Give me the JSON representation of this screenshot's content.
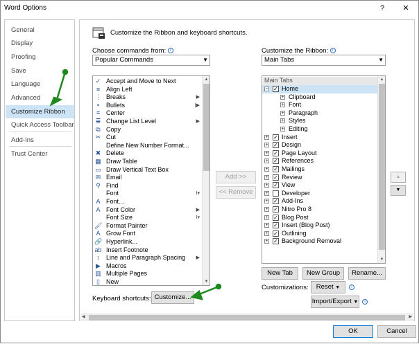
{
  "window": {
    "title": "Word Options",
    "help": "?",
    "close": "✕"
  },
  "nav": [
    {
      "label": "General"
    },
    {
      "label": "Display"
    },
    {
      "label": "Proofing"
    },
    {
      "label": "Save"
    },
    {
      "label": "Language"
    },
    {
      "label": "Advanced"
    },
    {
      "label": "Customize Ribbon",
      "selected": true
    },
    {
      "label": "Quick Access Toolbar"
    },
    {
      "label": "Add-Ins"
    },
    {
      "label": "Trust Center"
    }
  ],
  "header": {
    "text": "Customize the Ribbon and keyboard shortcuts."
  },
  "left": {
    "choose_label": "Choose commands from:",
    "choose_value": "Popular Commands",
    "commands": [
      {
        "label": "Accept and Move to Next",
        "icon": "accept-icon",
        "glyph": "✓"
      },
      {
        "label": "Align Left",
        "icon": "align-left-icon",
        "glyph": "≡"
      },
      {
        "label": "Breaks",
        "icon": "breaks-icon",
        "glyph": "⋮",
        "sub": "▶"
      },
      {
        "label": "Bullets",
        "icon": "bullets-icon",
        "glyph": "•",
        "sub": "|▶"
      },
      {
        "label": "Center",
        "icon": "center-icon",
        "glyph": "≡"
      },
      {
        "label": "Change List Level",
        "icon": "list-level-icon",
        "glyph": "≣",
        "sub": "▶"
      },
      {
        "label": "Copy",
        "icon": "copy-icon",
        "glyph": "⧉"
      },
      {
        "label": "Cut",
        "icon": "cut-icon",
        "glyph": "✂"
      },
      {
        "label": "Define New Number Format...",
        "icon": "",
        "glyph": ""
      },
      {
        "label": "Delete",
        "icon": "delete-icon",
        "glyph": "✖"
      },
      {
        "label": "Draw Table",
        "icon": "draw-table-icon",
        "glyph": "▦"
      },
      {
        "label": "Draw Vertical Text Box",
        "icon": "text-box-icon",
        "glyph": "▭"
      },
      {
        "label": "Email",
        "icon": "email-icon",
        "glyph": "✉"
      },
      {
        "label": "Find",
        "icon": "find-icon",
        "glyph": "⚲"
      },
      {
        "label": "Font",
        "icon": "",
        "glyph": "",
        "sub": "I▾"
      },
      {
        "label": "Font...",
        "icon": "font-dialog-icon",
        "glyph": "A"
      },
      {
        "label": "Font Color",
        "icon": "font-color-icon",
        "glyph": "A",
        "sub": "▶"
      },
      {
        "label": "Font Size",
        "icon": "",
        "glyph": "",
        "sub": "I▾"
      },
      {
        "label": "Format Painter",
        "icon": "format-painter-icon",
        "glyph": "🖌"
      },
      {
        "label": "Grow Font",
        "icon": "grow-font-icon",
        "glyph": "A"
      },
      {
        "label": "Hyperlink...",
        "icon": "hyperlink-icon",
        "glyph": "🔗"
      },
      {
        "label": "Insert Footnote",
        "icon": "footnote-icon",
        "glyph": "ab"
      },
      {
        "label": "Line and Paragraph Spacing",
        "icon": "spacing-icon",
        "glyph": "↕",
        "sub": "▶"
      },
      {
        "label": "Macros",
        "icon": "macros-icon",
        "glyph": "▶"
      },
      {
        "label": "Multiple Pages",
        "icon": "pages-icon",
        "glyph": "▥"
      },
      {
        "label": "New",
        "icon": "new-doc-icon",
        "glyph": "▯"
      }
    ],
    "kbd_label": "Keyboard shortcuts:",
    "customize_btn": "Customize..."
  },
  "mid": {
    "add": "Add >>",
    "remove": "<< Remove"
  },
  "right": {
    "customize_label": "Customize the Ribbon:",
    "customize_value": "Main Tabs",
    "tree_header": "Main Tabs",
    "tree": [
      {
        "label": "Home",
        "level": 0,
        "exp": "−",
        "checked": true,
        "sel": true
      },
      {
        "label": "Clipboard",
        "level": 1,
        "exp": "+"
      },
      {
        "label": "Font",
        "level": 1,
        "exp": "+"
      },
      {
        "label": "Paragraph",
        "level": 1,
        "exp": "+"
      },
      {
        "label": "Styles",
        "level": 1,
        "exp": "+"
      },
      {
        "label": "Editing",
        "level": 1,
        "exp": "+"
      },
      {
        "label": "Insert",
        "level": 0,
        "exp": "+",
        "checked": true
      },
      {
        "label": "Design",
        "level": 0,
        "exp": "+",
        "checked": true
      },
      {
        "label": "Page Layout",
        "level": 0,
        "exp": "+",
        "checked": true
      },
      {
        "label": "References",
        "level": 0,
        "exp": "+",
        "checked": true
      },
      {
        "label": "Mailings",
        "level": 0,
        "exp": "+",
        "checked": true
      },
      {
        "label": "Review",
        "level": 0,
        "exp": "+",
        "checked": true
      },
      {
        "label": "View",
        "level": 0,
        "exp": "+",
        "checked": true
      },
      {
        "label": "Developer",
        "level": 0,
        "exp": "+",
        "checked": false
      },
      {
        "label": "Add-Ins",
        "level": 0,
        "exp": "+",
        "checked": true
      },
      {
        "label": "Nitro Pro 8",
        "level": 0,
        "exp": "+",
        "checked": true
      },
      {
        "label": "Blog Post",
        "level": 0,
        "exp": "+",
        "checked": true
      },
      {
        "label": "Insert (Blog Post)",
        "level": 0,
        "exp": "+",
        "checked": true
      },
      {
        "label": "Outlining",
        "level": 0,
        "exp": "+",
        "checked": true
      },
      {
        "label": "Background Removal",
        "level": 0,
        "exp": "+",
        "checked": true
      }
    ],
    "new_tab": "New Tab",
    "new_group": "New Group",
    "rename": "Rename...",
    "customizations_label": "Customizations:",
    "reset": "Reset",
    "import_export": "Import/Export",
    "move_up": "▲",
    "move_down": "▼"
  },
  "footer": {
    "ok": "OK",
    "cancel": "Cancel"
  },
  "colors": {
    "accent": "#0078d7",
    "annotation": "#1e8a1e"
  }
}
